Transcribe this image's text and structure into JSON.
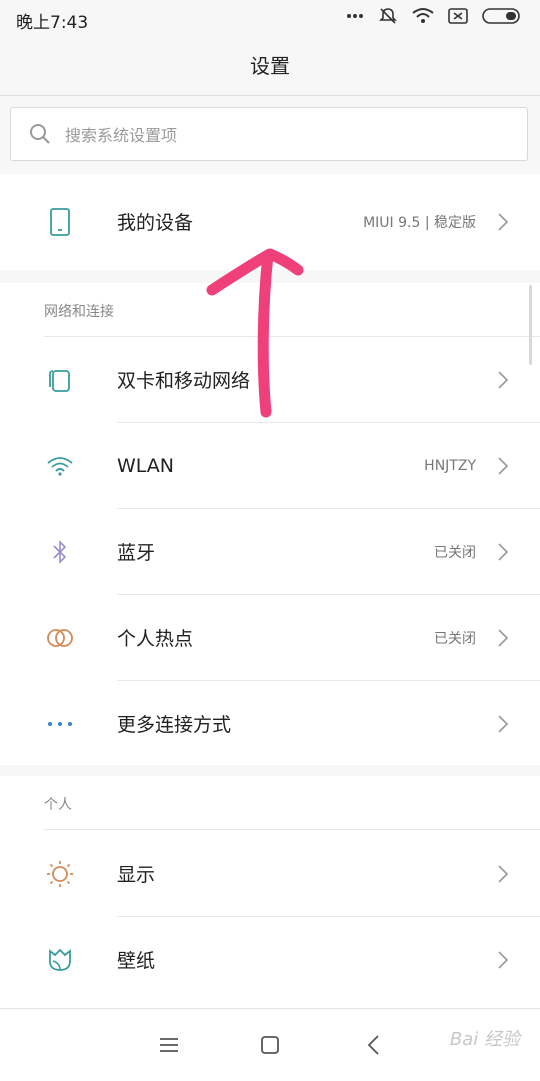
{
  "status_bar": {
    "time": "晚上7:43"
  },
  "header": {
    "title": "设置"
  },
  "search": {
    "placeholder": "搜索系统设置项"
  },
  "device": {
    "label": "我的设备",
    "value": "MIUI 9.5 | 稳定版"
  },
  "sections": [
    {
      "title": "网络和连接",
      "items": [
        {
          "label": "双卡和移动网络",
          "value": ""
        },
        {
          "label": "WLAN",
          "value": "HNJTZY"
        },
        {
          "label": "蓝牙",
          "value": "已关闭"
        },
        {
          "label": "个人热点",
          "value": "已关闭"
        },
        {
          "label": "更多连接方式",
          "value": ""
        }
      ]
    },
    {
      "title": "个人",
      "items": [
        {
          "label": "显示",
          "value": ""
        },
        {
          "label": "壁纸",
          "value": ""
        }
      ]
    }
  ],
  "watermark": "Bai 经验",
  "colors": {
    "accent": "#3a9c9c",
    "annotation_arrow": "#f0407a"
  }
}
